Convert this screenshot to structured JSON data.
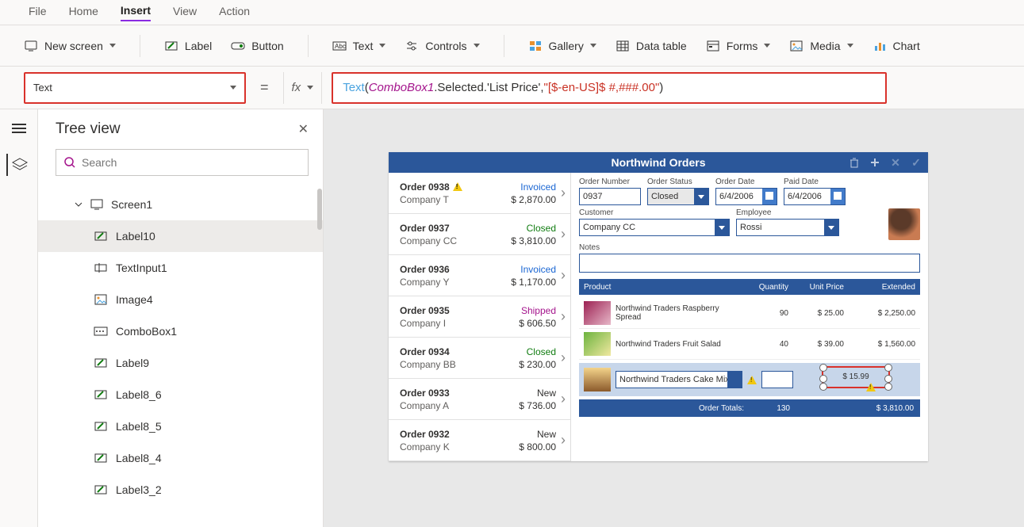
{
  "menu": {
    "items": [
      "File",
      "Home",
      "Insert",
      "View",
      "Action"
    ],
    "active": "Insert"
  },
  "ribbon": {
    "new_screen": "New screen",
    "label": "Label",
    "button": "Button",
    "text": "Text",
    "controls": "Controls",
    "gallery": "Gallery",
    "data_table": "Data table",
    "forms": "Forms",
    "media": "Media",
    "chart": "Chart"
  },
  "property_selector": "Text",
  "formula_parts": {
    "fn": "Text",
    "open": "( ",
    "id": "ComboBox1",
    "path": ".Selected.'List Price', ",
    "fmt": "\"[$-en-US]$ #,###.00\"",
    "close": " )"
  },
  "tree": {
    "title": "Tree view",
    "search_placeholder": "Search",
    "root": "Screen1",
    "items": [
      "Label10",
      "TextInput1",
      "Image4",
      "ComboBox1",
      "Label9",
      "Label8_6",
      "Label8_5",
      "Label8_4",
      "Label3_2"
    ],
    "selected": "Label10"
  },
  "app": {
    "title": "Northwind Orders",
    "orders": [
      {
        "num": "Order 0938",
        "warn": true,
        "company": "Company T",
        "status": "Invoiced",
        "status_cls": "st-invoiced",
        "amount": "$ 2,870.00"
      },
      {
        "num": "Order 0937",
        "company": "Company CC",
        "status": "Closed",
        "status_cls": "st-closed",
        "amount": "$ 3,810.00"
      },
      {
        "num": "Order 0936",
        "company": "Company Y",
        "status": "Invoiced",
        "status_cls": "st-invoiced",
        "amount": "$ 1,170.00"
      },
      {
        "num": "Order 0935",
        "company": "Company I",
        "status": "Shipped",
        "status_cls": "st-shipped",
        "amount": "$ 606.50"
      },
      {
        "num": "Order 0934",
        "company": "Company BB",
        "status": "Closed",
        "status_cls": "st-closed",
        "amount": "$ 230.00"
      },
      {
        "num": "Order 0933",
        "company": "Company A",
        "status": "New",
        "status_cls": "st-new",
        "amount": "$ 736.00"
      },
      {
        "num": "Order 0932",
        "company": "Company K",
        "status": "New",
        "status_cls": "st-new",
        "amount": "$ 800.00"
      }
    ],
    "detail": {
      "labels": {
        "order_number": "Order Number",
        "order_status": "Order Status",
        "order_date": "Order Date",
        "paid_date": "Paid Date",
        "customer": "Customer",
        "employee": "Employee",
        "notes": "Notes"
      },
      "order_number": "0937",
      "order_status": "Closed",
      "order_date": "6/4/2006",
      "paid_date": "6/4/2006",
      "customer": "Company CC",
      "employee": "Rossi",
      "notes": ""
    },
    "grid": {
      "headers": {
        "product": "Product",
        "qty": "Quantity",
        "unit": "Unit Price",
        "ext": "Extended"
      },
      "lines": [
        {
          "name": "Northwind Traders Raspberry Spread",
          "qty": "90",
          "unit": "$ 25.00",
          "ext": "$ 2,250.00",
          "thumb": ""
        },
        {
          "name": "Northwind Traders Fruit Salad",
          "qty": "40",
          "unit": "$ 39.00",
          "ext": "$ 1,560.00",
          "thumb": "g"
        }
      ],
      "editline": {
        "product": "Northwind Traders Cake Mix",
        "selected_value": "$ 15.99"
      },
      "totals": {
        "label": "Order Totals:",
        "qty": "130",
        "amount": "$ 3,810.00"
      }
    }
  }
}
